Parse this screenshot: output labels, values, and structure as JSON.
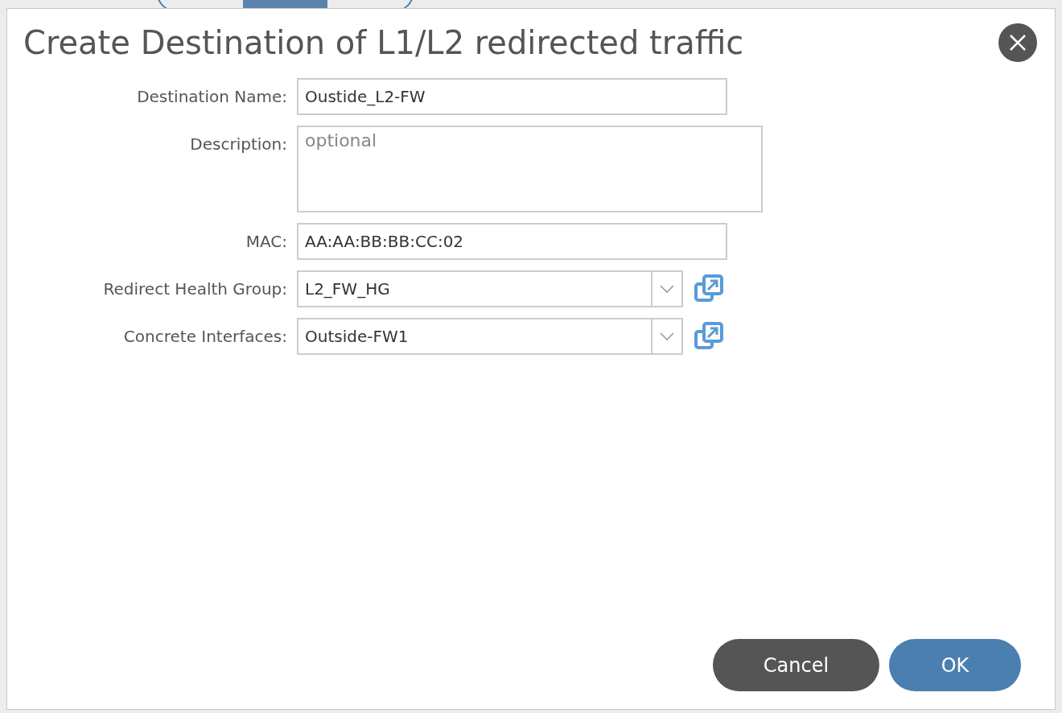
{
  "background_tabs": [
    {
      "selected": false
    },
    {
      "selected": true
    },
    {
      "selected": false
    }
  ],
  "dialog": {
    "title": "Create Destination of L1/L2 redirected traffic",
    "fields": [
      {
        "kind": "text",
        "label": "Destination Name:",
        "value": "Oustide_L2-FW"
      },
      {
        "kind": "textarea",
        "label": "Description:",
        "placeholder": "optional"
      },
      {
        "kind": "text",
        "label": "MAC:",
        "value": "AA:AA:BB:BB:CC:02"
      },
      {
        "kind": "select",
        "label": "Redirect Health Group:",
        "value": "L2_FW_HG"
      },
      {
        "kind": "select",
        "label": "Concrete Interfaces:",
        "value": "Outside-FW1"
      }
    ],
    "buttons": [
      {
        "kind": "secondary",
        "label": "Cancel"
      },
      {
        "kind": "primary",
        "label": "OK"
      }
    ]
  }
}
